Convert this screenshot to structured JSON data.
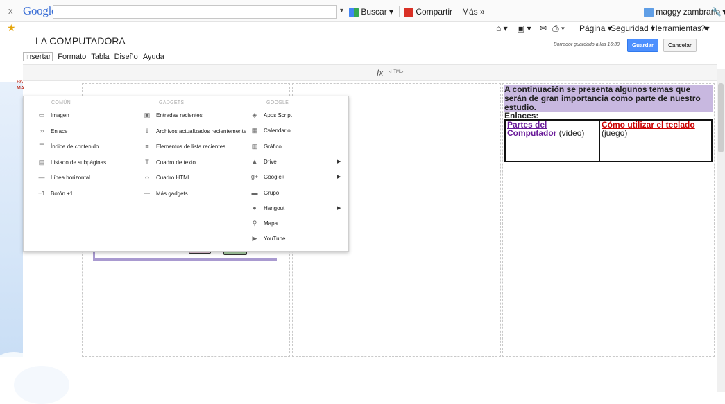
{
  "google_toolbar": {
    "close": "x",
    "logo": "Google",
    "search_value": "",
    "search_btn": "Buscar",
    "share_btn": "Compartir",
    "more": "Más »",
    "user": "maggy zambrano"
  },
  "ie_commands": {
    "page": "Página",
    "security": "Seguridad",
    "tools": "Herramientas"
  },
  "editor": {
    "site_title": "LA COMPUTADORA",
    "menu": [
      "Insertar",
      "Formato",
      "Tabla",
      "Diseño",
      "Ayuda"
    ],
    "saved_note": "Borrador guardado a las 16:30",
    "save": "Guardar",
    "cancel": "Cancelar",
    "clear_format": "Ix",
    "html": "‹HTML›"
  },
  "gutter_text": "PA\nMA",
  "dropdown": {
    "headers": [
      "COMÚN",
      "GADGETS",
      "GOOGLE"
    ],
    "common": [
      {
        "label": "Imagen",
        "icon": "image-icon",
        "glyph": "▭"
      },
      {
        "label": "Enlace",
        "icon": "link-icon",
        "glyph": "∞"
      },
      {
        "label": "Índice de contenido",
        "icon": "toc-icon",
        "glyph": "☰"
      },
      {
        "label": "Listado de subpáginas",
        "icon": "subpages-icon",
        "glyph": "▤"
      },
      {
        "label": "Línea horizontal",
        "icon": "hr-icon",
        "glyph": "—"
      },
      {
        "label": "Botón +1",
        "icon": "plus-one-icon",
        "glyph": "+1"
      }
    ],
    "gadgets": [
      {
        "label": "Entradas recientes",
        "icon": "recent-posts-icon",
        "glyph": "▣"
      },
      {
        "label": "Archivos actualizados recientemente",
        "icon": "recent-files-icon",
        "glyph": "⇧"
      },
      {
        "label": "Elementos de lista recientes",
        "icon": "recent-list-icon",
        "glyph": "≡"
      },
      {
        "label": "Cuadro de texto",
        "icon": "textbox-icon",
        "glyph": "T"
      },
      {
        "label": "Cuadro HTML",
        "icon": "html-box-icon",
        "glyph": "‹›"
      },
      {
        "label": "Más gadgets...",
        "icon": "more-gadgets-icon",
        "glyph": "···"
      }
    ],
    "google": [
      {
        "label": "Apps Script",
        "icon": "apps-script-icon",
        "glyph": "◈",
        "submenu": false
      },
      {
        "label": "Calendario",
        "icon": "calendar-icon",
        "glyph": "▦",
        "submenu": false
      },
      {
        "label": "Gráfico",
        "icon": "chart-icon",
        "glyph": "▥",
        "submenu": false
      },
      {
        "label": "Drive",
        "icon": "drive-icon",
        "glyph": "▲",
        "submenu": true
      },
      {
        "label": "Google+",
        "icon": "google-plus-icon",
        "glyph": "g+",
        "submenu": true
      },
      {
        "label": "Grupo",
        "icon": "group-icon",
        "glyph": "▬",
        "submenu": false
      },
      {
        "label": "Hangout",
        "icon": "hangout-icon",
        "glyph": "●",
        "submenu": true
      },
      {
        "label": "Mapa",
        "icon": "map-pin-icon",
        "glyph": "⚲",
        "submenu": false
      },
      {
        "label": "YouTube",
        "icon": "youtube-icon",
        "glyph": "▶",
        "submenu": false
      }
    ]
  },
  "content": {
    "intro": "A continuación se presenta algunos temas que serán de gran importancia como parte de  nuestro estudio.",
    "links_heading": "Enlaces:",
    "link1": "Partes del Computador",
    "link1_suffix": " (video)",
    "link2": "Cómo utilizar el teclado",
    "link2_suffix": " (juego)"
  }
}
